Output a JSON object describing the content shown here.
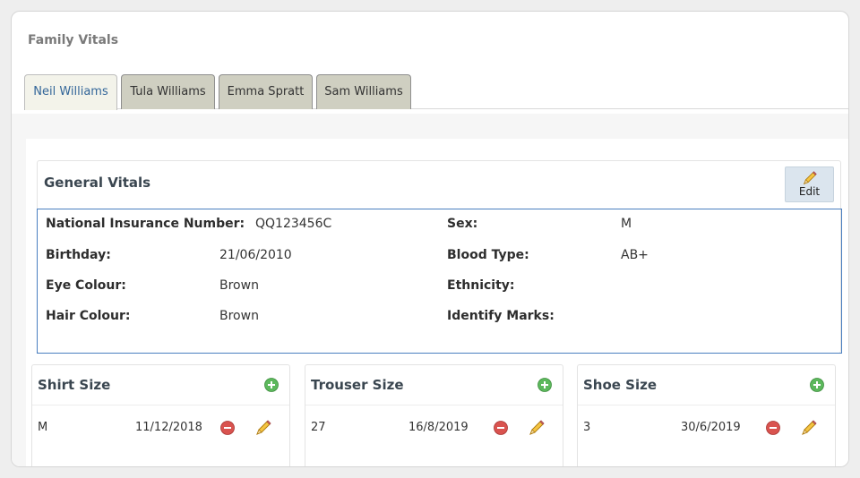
{
  "panel": {
    "title": "Family Vitals"
  },
  "tabs": [
    {
      "label": "Neil Williams",
      "active": true
    },
    {
      "label": "Tula Williams",
      "active": false
    },
    {
      "label": "Emma Spratt",
      "active": false
    },
    {
      "label": "Sam Williams",
      "active": false
    }
  ],
  "general_vitals": {
    "title": "General Vitals",
    "edit_label": "Edit",
    "fields": {
      "ni_label": "National Insurance Number:",
      "ni_value": "QQ123456C",
      "birthday_label": "Birthday:",
      "birthday_value": "21/06/2010",
      "eye_label": "Eye Colour:",
      "eye_value": "Brown",
      "hair_label": "Hair Colour:",
      "hair_value": "Brown",
      "sex_label": "Sex:",
      "sex_value": "M",
      "blood_label": "Blood Type:",
      "blood_value": "AB+",
      "ethnicity_label": "Ethnicity:",
      "ethnicity_value": "",
      "marks_label": "Identify Marks:",
      "marks_value": ""
    }
  },
  "sizes": [
    {
      "title": "Shirt Size",
      "value": "M",
      "date": "11/12/2018"
    },
    {
      "title": "Trouser Size",
      "value": "27",
      "date": "16/8/2019"
    },
    {
      "title": "Shoe Size",
      "value": "3",
      "date": "30/6/2019"
    }
  ],
  "colors": {
    "active_tab_text": "#336699",
    "inactive_tab_bg": "#cfcfc1",
    "vitals_border": "#4a7fc0",
    "add_icon": "#5cb85c",
    "remove_icon": "#d9534f"
  },
  "icons": {
    "edit": "pencil-icon",
    "add": "plus-circle-icon",
    "remove": "minus-circle-icon"
  }
}
